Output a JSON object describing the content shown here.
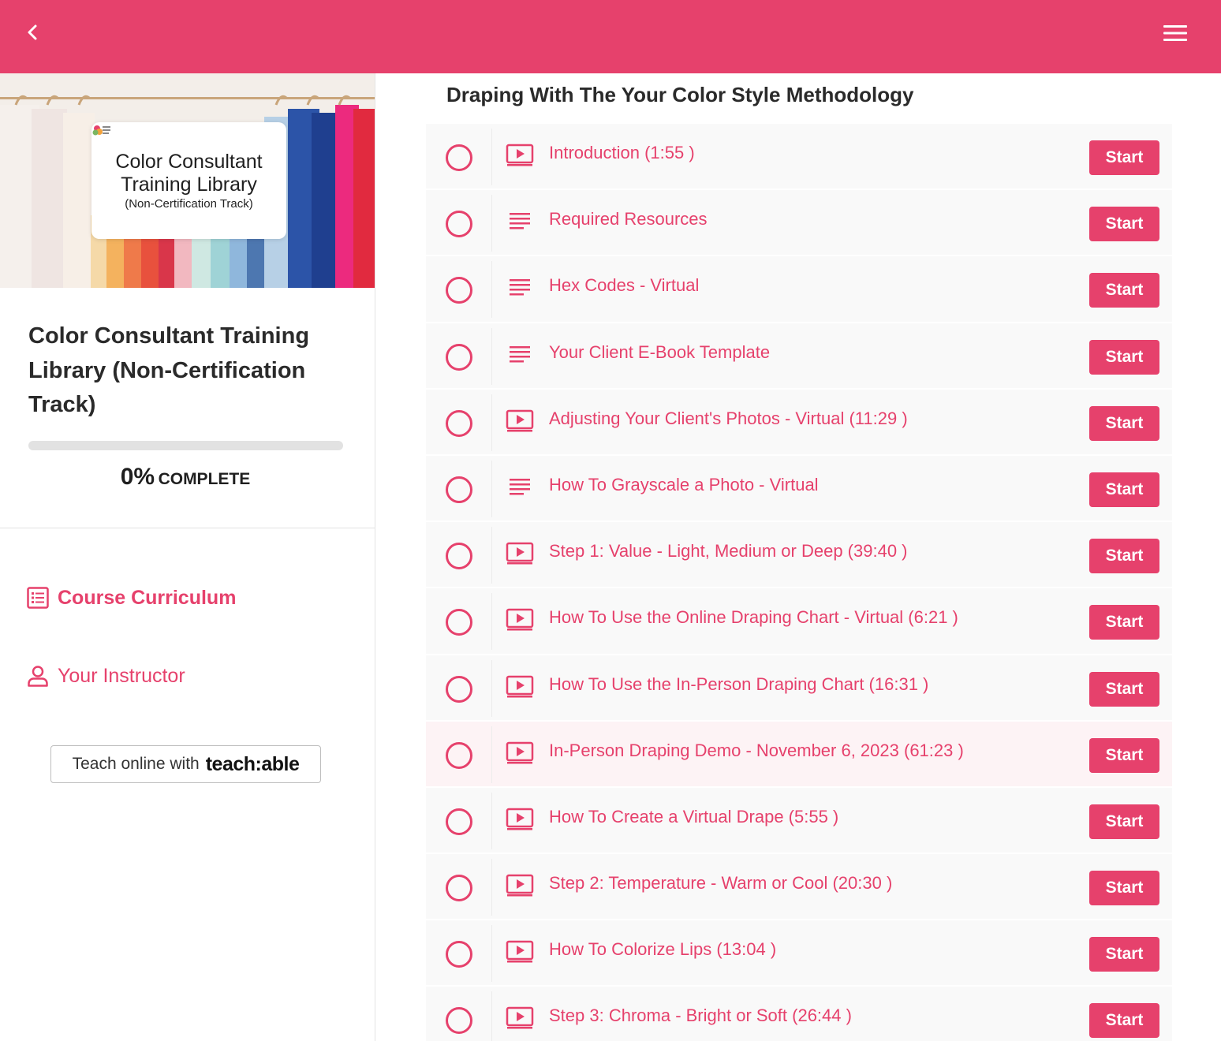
{
  "colors": {
    "accent": "#e6416c",
    "background": "#ffffff",
    "row_bg": "#f9f9f9",
    "row_highlight": "#fdf3f5"
  },
  "topbar": {
    "back_icon": "chevron-left-icon",
    "menu_icon": "hamburger-menu-icon"
  },
  "sidebar": {
    "hero": {
      "card_title": "Color Consultant Training Library",
      "card_subtitle": "(Non-Certification Track)"
    },
    "course_title": "Color Consultant Training Library (Non-Certification Track)",
    "progress": {
      "percent": 0,
      "percent_label": "0%",
      "label": "COMPLETE"
    },
    "nav": [
      {
        "label": "Course Curriculum",
        "icon": "curriculum-list-icon"
      },
      {
        "label": "Your Instructor",
        "icon": "person-icon"
      }
    ],
    "teachable_badge": {
      "prefix": "Teach online with",
      "brand": "teach:able"
    }
  },
  "main": {
    "section_title": "Draping With The Your Color Style Methodology",
    "start_label": "Start",
    "lessons": [
      {
        "title": "Introduction (1:55 )",
        "type": "video"
      },
      {
        "title": "Required Resources",
        "type": "text"
      },
      {
        "title": "Hex Codes - Virtual",
        "type": "text"
      },
      {
        "title": "Your Client E-Book Template",
        "type": "text"
      },
      {
        "title": "Adjusting Your Client's Photos - Virtual (11:29 )",
        "type": "video"
      },
      {
        "title": "How To Grayscale a Photo - Virtual",
        "type": "text"
      },
      {
        "title": "Step 1: Value - Light, Medium or Deep (39:40 )",
        "type": "video"
      },
      {
        "title": "How To Use the Online Draping Chart - Virtual (6:21 )",
        "type": "video"
      },
      {
        "title": "How To Use the In-Person Draping Chart (16:31 )",
        "type": "video"
      },
      {
        "title": "In-Person Draping Demo - November 6, 2023 (61:23 )",
        "type": "video",
        "highlighted": true
      },
      {
        "title": "How To Create a Virtual Drape (5:55 )",
        "type": "video"
      },
      {
        "title": "Step 2: Temperature - Warm or Cool (20:30 )",
        "type": "video"
      },
      {
        "title": "How To Colorize Lips (13:04 )",
        "type": "video"
      },
      {
        "title": "Step 3: Chroma - Bright or Soft (26:44 )",
        "type": "video"
      }
    ]
  }
}
